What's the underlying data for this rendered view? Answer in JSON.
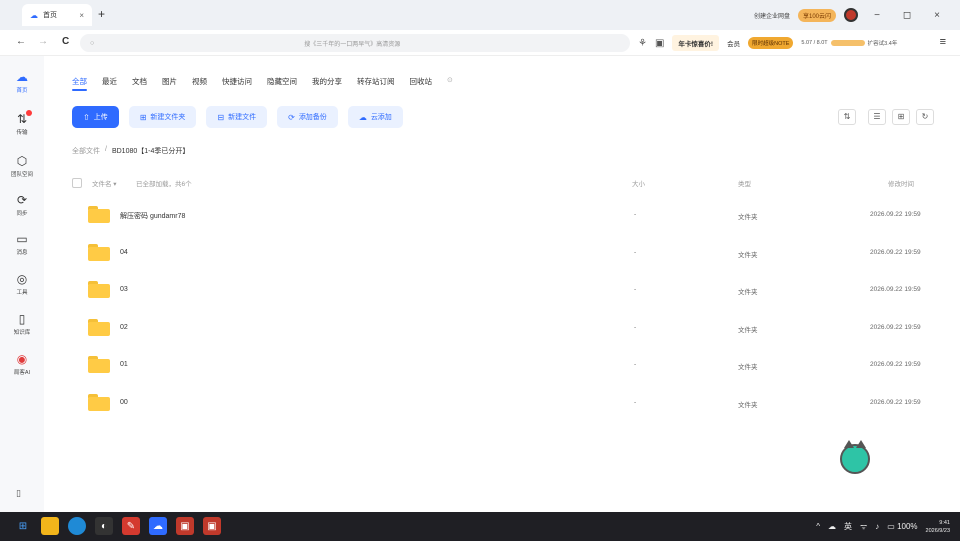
{
  "browser": {
    "tab_title": "首页",
    "tab_close": "×",
    "new_tab": "+",
    "right_action": "创建企业网盘",
    "right_badge": "享100云闪",
    "window": {
      "minimize": "−",
      "maximize": "◻",
      "close": "×"
    }
  },
  "address": {
    "back": "←",
    "forward": "→",
    "reload": "C",
    "placeholder": "搜《三千年的一口两早气》高清资源",
    "promo": "年卡惊喜价!",
    "vip_label": "会员",
    "vip_badge": "限时超级NOTE",
    "storage_text": "5.07 / 8.0T",
    "storage_tag": "扩容试3.4年",
    "menu": "≡"
  },
  "sidebar": {
    "items": [
      {
        "label": "首页",
        "icon": "cloud-icon"
      },
      {
        "label": "传输",
        "icon": "transfer-icon"
      },
      {
        "label": "团队空间",
        "icon": "team-icon"
      },
      {
        "label": "同步",
        "icon": "sync-icon"
      },
      {
        "label": "消息",
        "icon": "message-icon"
      },
      {
        "label": "工具",
        "icon": "tools-icon"
      },
      {
        "label": "知识库",
        "icon": "library-icon"
      },
      {
        "label": "局客AI",
        "icon": "ai-icon"
      }
    ],
    "bottom_icon": "▯"
  },
  "categories": [
    "全部",
    "最近",
    "文档",
    "图片",
    "视频",
    "快捷访问",
    "隐藏空间",
    "我的分享",
    "转存站订阅",
    "回收站"
  ],
  "category_help": "⊙",
  "actions": {
    "upload": "上传",
    "new_folder": "新建文件夹",
    "new_file": "新建文件",
    "add_backup": "添加备份",
    "cloud_add": "云添加"
  },
  "view_tools": [
    "⇅",
    "☰",
    "⊞",
    "↻"
  ],
  "breadcrumb": {
    "root": "全部文件",
    "sep": "/",
    "current": "BD1080【1-4季已分开】"
  },
  "table": {
    "col_name": "文件名",
    "col_hint": "已全部加载，共6个",
    "col_size": "大小",
    "col_type": "类型",
    "col_date": "修改时间",
    "rows": [
      {
        "name": "解压密码 gundamr78",
        "size": "-",
        "type": "文件夹",
        "date": "2026.09.22 19:59"
      },
      {
        "name": "04",
        "size": "-",
        "type": "文件夹",
        "date": "2026.09.22 19:59"
      },
      {
        "name": "03",
        "size": "-",
        "type": "文件夹",
        "date": "2026.09.22 19:59"
      },
      {
        "name": "02",
        "size": "-",
        "type": "文件夹",
        "date": "2026.09.22 19:59"
      },
      {
        "name": "01",
        "size": "-",
        "type": "文件夹",
        "date": "2026.09.22 19:59"
      },
      {
        "name": "00",
        "size": "-",
        "type": "文件夹",
        "date": "2026.09.22 19:59"
      }
    ]
  },
  "taskbar": {
    "tray_ime": "英",
    "battery": "100%",
    "time": "9:41",
    "date": "2026/9/23"
  },
  "colors": {
    "accent": "#2f6bff",
    "folder": "#ffcb45",
    "taskbar": "#1f1f24"
  }
}
